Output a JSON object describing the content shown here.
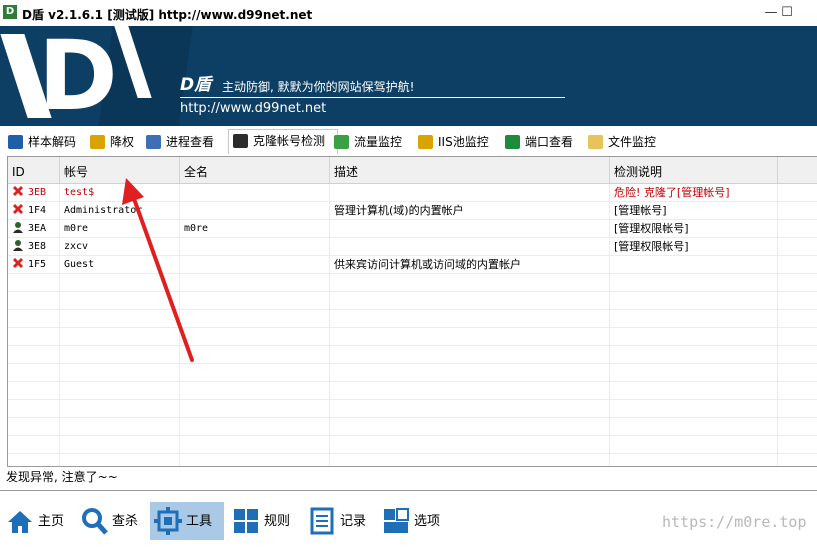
{
  "window": {
    "title": "D盾 v2.1.6.1 [测试版] http://www.d99net.net",
    "app_icon": "D",
    "minimize_glyph": "—",
    "maximize_glyph": "☐"
  },
  "banner": {
    "brand": "D盾",
    "slogan": "主动防御, 默默为你的网站保驾护航!",
    "url": "http://www.d99net.net"
  },
  "tabs": [
    {
      "label": "样本解码",
      "icon": "pen-icon",
      "color": "#1e5fa8"
    },
    {
      "label": "降权",
      "icon": "document-lock-icon",
      "color": "#d9a400"
    },
    {
      "label": "进程查看",
      "icon": "window-icon",
      "color": "#3c6fb4"
    },
    {
      "label": "克隆帐号检测",
      "icon": "user-icon",
      "color": "#2b2b2b",
      "active": true
    },
    {
      "label": "流量监控",
      "icon": "chart-icon",
      "color": "#3aa043"
    },
    {
      "label": "IIS池监控",
      "icon": "server-icon",
      "color": "#d9a400"
    },
    {
      "label": "端口查看",
      "icon": "globe-icon",
      "color": "#1d8c3a"
    },
    {
      "label": "文件监控",
      "icon": "folder-icon",
      "color": "#e8c35a"
    }
  ],
  "table": {
    "columns": [
      "ID",
      "帐号",
      "全名",
      "描述",
      "检测说明"
    ],
    "rows": [
      {
        "icon": "x",
        "id": "3EB",
        "account": "test$",
        "fullname": "",
        "desc": "",
        "note": "危险! 克隆了[管理帐号]",
        "danger": true
      },
      {
        "icon": "x",
        "id": "1F4",
        "account": "Administrator",
        "fullname": "",
        "desc": "管理计算机(域)的内置帐户",
        "note": "[管理帐号]"
      },
      {
        "icon": "user",
        "id": "3EA",
        "account": "m0re",
        "fullname": "m0re",
        "desc": "",
        "note": "[管理权限帐号]"
      },
      {
        "icon": "user",
        "id": "3E8",
        "account": "zxcv",
        "fullname": "",
        "desc": "",
        "note": "[管理权限帐号]"
      },
      {
        "icon": "x",
        "id": "1F5",
        "account": "Guest",
        "fullname": "",
        "desc": "供来宾访问计算机或访问域的内置帐户",
        "note": ""
      }
    ]
  },
  "status": "发现异常, 注意了~~",
  "toolbar": [
    {
      "label": "主页",
      "icon": "home-icon"
    },
    {
      "label": "查杀",
      "icon": "magnifier-icon"
    },
    {
      "label": "工具",
      "icon": "tools-icon",
      "active": true
    },
    {
      "label": "规则",
      "icon": "grid-icon"
    },
    {
      "label": "记录",
      "icon": "log-icon"
    },
    {
      "label": "选项",
      "icon": "options-icon"
    }
  ],
  "watermark": "https://m0re.top",
  "colors": {
    "banner": "#0d3f64",
    "accent_blue": "#1e6fb8",
    "danger": "#c00000",
    "active_tool": "#a9c9e6"
  }
}
